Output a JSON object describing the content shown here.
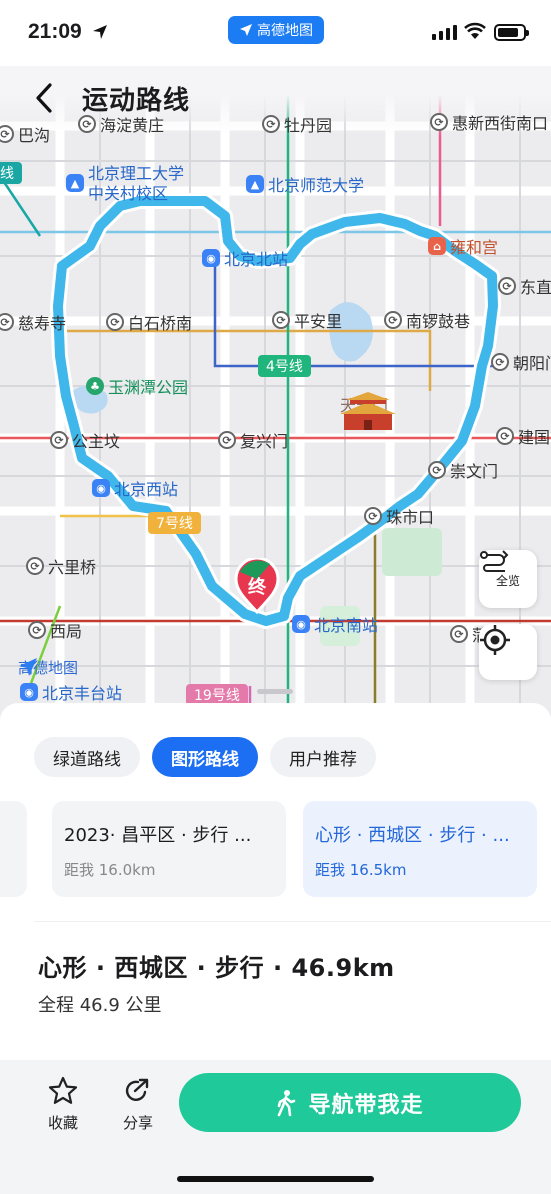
{
  "status": {
    "time": "21:09",
    "app_badge": "高德地图"
  },
  "header": {
    "title": "运动路线"
  },
  "map": {
    "pois": [
      {
        "name": "巴沟",
        "type": "station"
      },
      {
        "name": "海淀黄庄",
        "type": "station"
      },
      {
        "name": "牡丹园",
        "type": "station"
      },
      {
        "name": "惠新西街南口",
        "type": "station"
      },
      {
        "name": "北京理工大学\n中关村校区",
        "type": "school"
      },
      {
        "name": "北京师范大学",
        "type": "school"
      },
      {
        "name": "北京北站",
        "type": "rail"
      },
      {
        "name": "雍和宫",
        "type": "temple"
      },
      {
        "name": "东直",
        "type": "station"
      },
      {
        "name": "慈寿寺",
        "type": "station"
      },
      {
        "name": "白石桥南",
        "type": "station"
      },
      {
        "name": "平安里",
        "type": "station"
      },
      {
        "name": "南锣鼓巷",
        "type": "station"
      },
      {
        "name": "朝阳门",
        "type": "station"
      },
      {
        "name": "玉渊潭公园",
        "type": "park"
      },
      {
        "name": "公主坟",
        "type": "station"
      },
      {
        "name": "复兴门",
        "type": "station"
      },
      {
        "name": "天安门",
        "type": "landmark"
      },
      {
        "name": "建国",
        "type": "station"
      },
      {
        "name": "崇文门",
        "type": "station"
      },
      {
        "name": "北京西站",
        "type": "rail"
      },
      {
        "name": "珠市口",
        "type": "station"
      },
      {
        "name": "六里桥",
        "type": "station"
      },
      {
        "name": "西局",
        "type": "station"
      },
      {
        "name": "北京南站",
        "type": "rail"
      },
      {
        "name": "蒲",
        "type": "station"
      },
      {
        "name": "北京丰台站",
        "type": "rail"
      }
    ],
    "line_tags": [
      "4号线",
      "7号线",
      "19号线",
      "线"
    ],
    "watermark": "高德地图",
    "end_marker": "终",
    "overview_button": "全览"
  },
  "tabs": [
    {
      "label": "绿道路线",
      "active": false
    },
    {
      "label": "图形路线",
      "active": true
    },
    {
      "label": "用户推荐",
      "active": false
    }
  ],
  "cards": [
    {
      "title": "2023· 昌平区 · 步行 ...",
      "distance": "距我 16.0km",
      "selected": false
    },
    {
      "title": "心形 · 西城区 · 步行 · ...",
      "distance": "距我 16.5km",
      "selected": true
    }
  ],
  "route": {
    "title": "心形 · 西城区 · 步行 · 46.9km",
    "subtitle": "全程 46.9 公里"
  },
  "actions": {
    "favorite": "收藏",
    "share": "分享",
    "navigate": "导航带我走"
  },
  "colors": {
    "accent": "#1c6ef2",
    "route": "#3fb7ea",
    "nav": "#1fc99a",
    "end_marker": "#e8364f"
  }
}
